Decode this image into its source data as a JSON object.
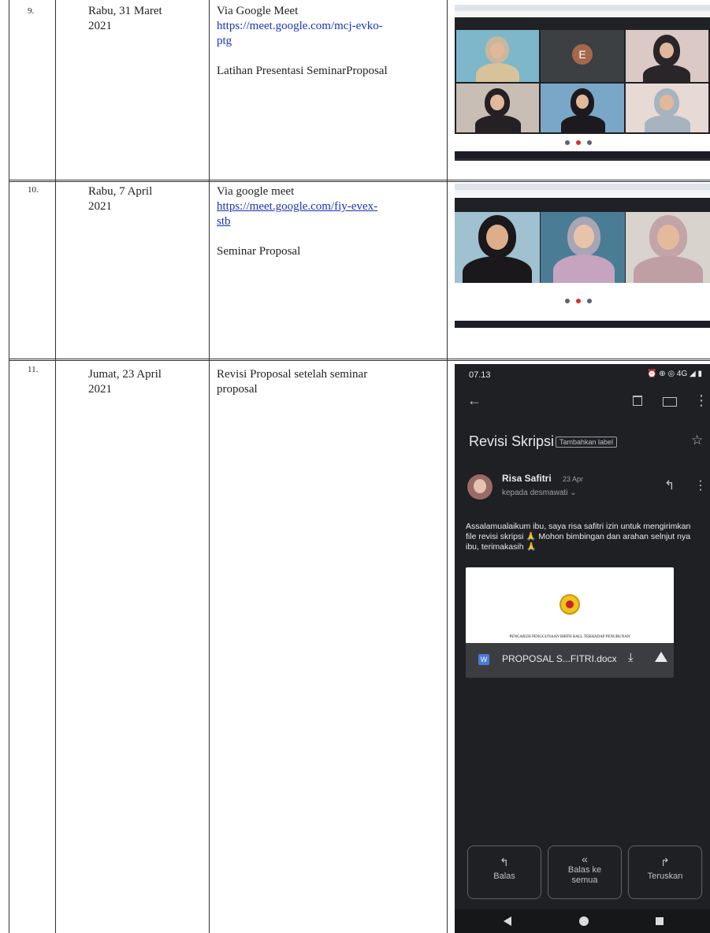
{
  "rows": [
    {
      "number": "9.",
      "date_line1": "Rabu, 31 Maret",
      "date_line2": "2021",
      "via": "Via Google Meet",
      "link_line1": "https://meet.google.com/mcj-evko-",
      "link_line2": "ptg",
      "activity": "Latihan Presentasi SeminarProposal",
      "tile_initial": "E"
    },
    {
      "number": "10.",
      "date_line1": "Rabu, 7 April",
      "date_line2": "2021",
      "via": "Via google meet",
      "link_line1": "https://meet.google.com/fiy-evex-",
      "link_line2": "stb",
      "activity": "Seminar Proposal"
    },
    {
      "number": "11.",
      "date_line1": "Jumat, 23 April",
      "date_line2": "2021",
      "activity_line1": "Revisi Proposal setelah seminar",
      "activity_line2": "proposal"
    }
  ],
  "email": {
    "time": "07.13",
    "status_icons": "⏰ ⊕ ◎ 4G ◢ ▮",
    "subject": "Revisi Skripsi",
    "label_chip": "Tambahkan label",
    "sender": "Risa Safitri",
    "date": "23 Apr",
    "to_line": "kepada desmawati",
    "body": "Assalamualaikum ibu, saya risa safitri izin untuk mengirimkan file revisi skripsi 🙏 Mohon bimbingan dan arahan selnjut nya ibu, terimakasih 🙏",
    "attachment_caption": "PENGARUH PENGGUNAAN BIRTH BALL TERHADAP PENURUNAN",
    "attachment_name": "PROPOSAL S...FITRI.docx",
    "attachment_type": "W",
    "buttons": {
      "reply": "Balas",
      "reply_all_line1": "Balas ke",
      "reply_all_line2": "semua",
      "forward": "Teruskan"
    }
  },
  "colors": {
    "link": "#1a33b4",
    "phone_bg": "#1f2023",
    "word_icon": "#4a7bd8",
    "meet_bg": "#202124"
  }
}
